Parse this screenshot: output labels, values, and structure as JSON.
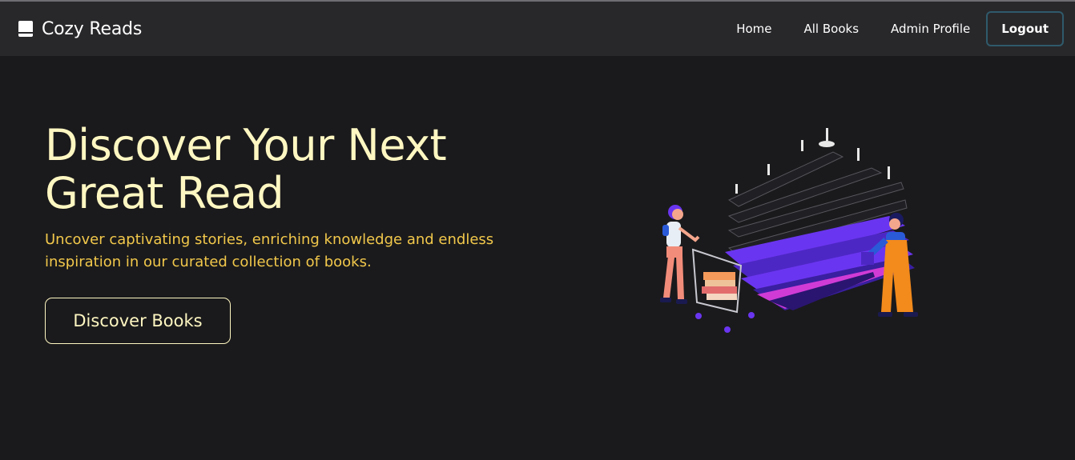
{
  "navbar": {
    "brand": "Cozy Reads",
    "brand_icon": "book-icon",
    "links": [
      "Home",
      "All Books",
      "Admin Profile"
    ],
    "logout_label": "Logout"
  },
  "hero": {
    "title": "Discover Your Next Great Read",
    "subtitle": "Uncover captivating stories, enriching knowledge and endless inspiration in our curated collection of books.",
    "cta_label": "Discover Books",
    "illustration": "isometric-bookstore-illustration"
  },
  "colors": {
    "background": "#1a1a1c",
    "navbar": "#28282b",
    "title": "#fff7c2",
    "subtitle": "#f2c84b",
    "logout_border": "#2f5a6b",
    "shelf_accent": "#6a35f0"
  }
}
